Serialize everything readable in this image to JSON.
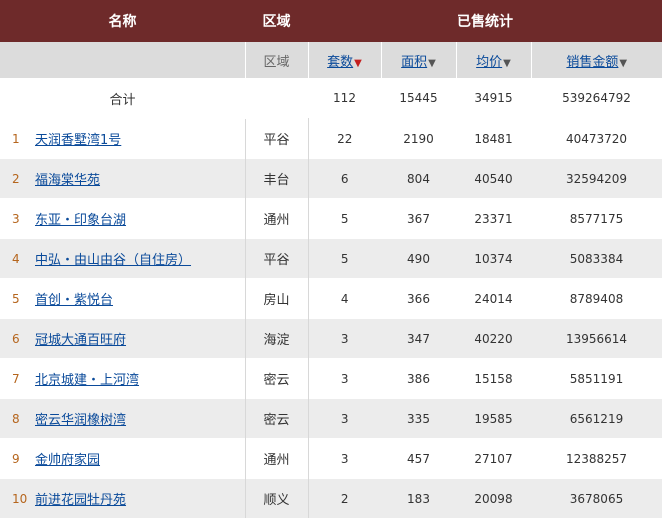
{
  "header": {
    "name_label": "名称",
    "region_label": "区域",
    "sold_stats_label": "已售统计"
  },
  "subheader": {
    "region": "区域",
    "units": "套数",
    "area": "面积",
    "avg_price": "均价",
    "sales_amount": "销售金额"
  },
  "total": {
    "label": "合计",
    "units": "112",
    "area": "15445",
    "avg_price": "34915",
    "sales_amount": "539264792"
  },
  "rows": [
    {
      "index": "1",
      "name": "天润香墅湾1号",
      "region": "平谷",
      "units": "22",
      "area": "2190",
      "avg_price": "18481",
      "sales_amount": "40473720"
    },
    {
      "index": "2",
      "name": "福海棠华苑",
      "region": "丰台",
      "units": "6",
      "area": "804",
      "avg_price": "40540",
      "sales_amount": "32594209"
    },
    {
      "index": "3",
      "name": "东亚・印象台湖",
      "region": "通州",
      "units": "5",
      "area": "367",
      "avg_price": "23371",
      "sales_amount": "8577175"
    },
    {
      "index": "4",
      "name": "中弘・由山由谷（自住房）",
      "region": "平谷",
      "units": "5",
      "area": "490",
      "avg_price": "10374",
      "sales_amount": "5083384"
    },
    {
      "index": "5",
      "name": "首创・紫悦台",
      "region": "房山",
      "units": "4",
      "area": "366",
      "avg_price": "24014",
      "sales_amount": "8789408"
    },
    {
      "index": "6",
      "name": "冠城大通百旺府",
      "region": "海淀",
      "units": "3",
      "area": "347",
      "avg_price": "40220",
      "sales_amount": "13956614"
    },
    {
      "index": "7",
      "name": "北京城建・上河湾",
      "region": "密云",
      "units": "3",
      "area": "386",
      "avg_price": "15158",
      "sales_amount": "5851191"
    },
    {
      "index": "8",
      "name": "密云华润橡树湾",
      "region": "密云",
      "units": "3",
      "area": "335",
      "avg_price": "19585",
      "sales_amount": "6561219"
    },
    {
      "index": "9",
      "name": "金帅府家园",
      "region": "通州",
      "units": "3",
      "area": "457",
      "avg_price": "27107",
      "sales_amount": "12388257"
    },
    {
      "index": "10",
      "name": "前进花园牡丹苑",
      "region": "顺义",
      "units": "2",
      "area": "183",
      "avg_price": "20098",
      "sales_amount": "3678065"
    }
  ],
  "colors": {
    "header_bg": "#6e2a2a",
    "subheader_bg": "#dcdcdc",
    "link": "#0a4a9a",
    "active_sort_arrow": "#c41f1f",
    "index_text": "#b5651d",
    "even_row_bg": "#ececec"
  },
  "icons": {
    "sort_active": "sort-down-arrow-red",
    "sort_inactive": "sort-down-arrow-gray"
  }
}
